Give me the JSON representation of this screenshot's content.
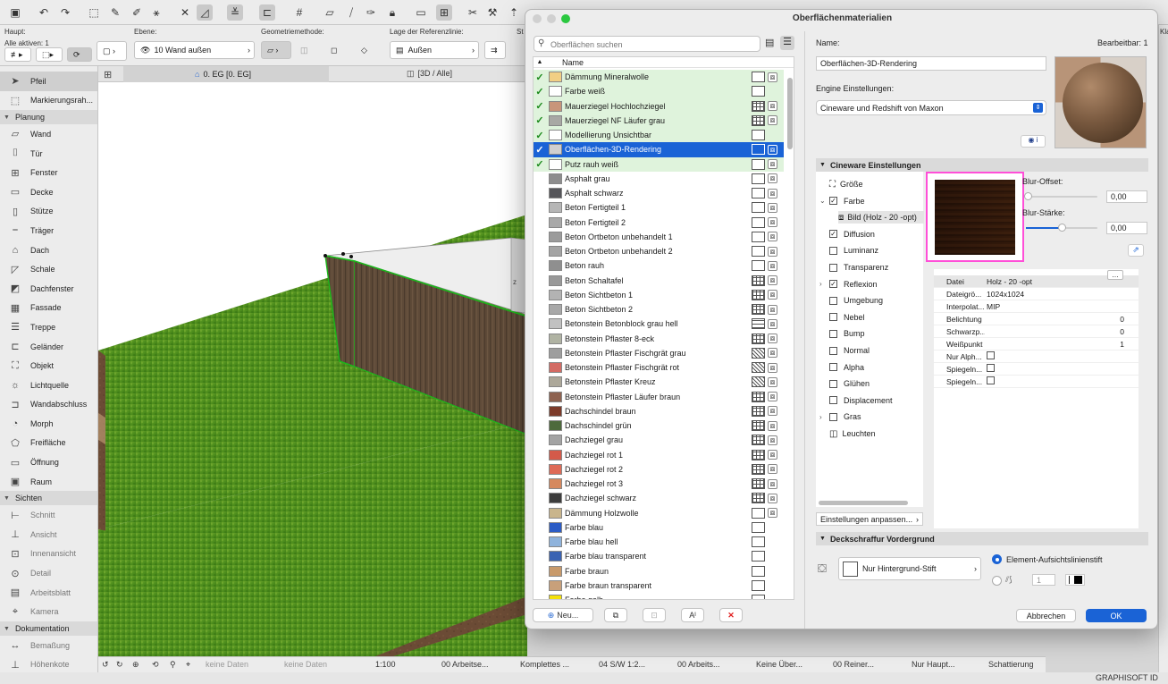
{
  "toolbar": {
    "haupt_label": "Haupt:",
    "alle_aktiven": "Alle aktiven: 1",
    "ebene_label": "Ebene:",
    "ebene_value": "10 Wand außen",
    "geometrie_label": "Geometriemethode:",
    "referenz_label": "Lage der Referenzlinie:",
    "referenz_value": "Außen",
    "st_label": "St"
  },
  "view_tabs": {
    "tab1": "0. EG [0. EG]",
    "tab2": "[3D / Alle]"
  },
  "palette": {
    "pfeil": "Pfeil",
    "markierung": "Markierungsrah...",
    "sections": {
      "planung": "Planung",
      "sichten": "Sichten",
      "dokumentation": "Dokumentation"
    },
    "planung_items": [
      "Wand",
      "Tür",
      "Fenster",
      "Decke",
      "Stütze",
      "Träger",
      "Dach",
      "Schale",
      "Dachfenster",
      "Fassade",
      "Treppe",
      "Geländer",
      "Objekt",
      "Lichtquelle",
      "Wandabschluss",
      "Morph",
      "Freifläche",
      "Öffnung",
      "Raum"
    ],
    "sichten_items": [
      "Schnitt",
      "Ansicht",
      "Innenansicht",
      "Detail",
      "Arbeitsblatt",
      "Kamera"
    ],
    "doku_items": [
      "Bemaßung",
      "Höhenkote"
    ]
  },
  "statusbar": {
    "keine_daten_1": "keine Daten",
    "keine_daten_2": "keine Daten",
    "scale": "1:100",
    "arbeitsebene": "00 Arbeitse...",
    "komplettes": "Komplettes ...",
    "stift": "04 S/W 1:2...",
    "arbeits": "00 Arbeits...",
    "keine_ueber": "Keine Über...",
    "reiner": "00 Reiner...",
    "haupt": "Nur Haupt...",
    "schattierung": "Schattierung"
  },
  "dialog": {
    "title": "Oberflächenmaterialien",
    "search_placeholder": "Oberflächen suchen",
    "list_header": "Name",
    "materials": [
      {
        "name": "Dämmung Mineralwolle",
        "color": "#f2cf84",
        "fav": true,
        "pat": "plain",
        "icon": true
      },
      {
        "name": "Farbe weiß",
        "color": "#ffffff",
        "fav": true,
        "pat": "plain",
        "icon": false
      },
      {
        "name": "Mauerziegel Hochlochziegel",
        "color": "#c8957a",
        "fav": true,
        "pat": "hatch2",
        "icon": true
      },
      {
        "name": "Mauerziegel NF Läufer grau",
        "color": "#a8a8a4",
        "fav": true,
        "pat": "hatch2",
        "icon": true
      },
      {
        "name": "Modellierung Unsichtbar",
        "color": "#ffffff",
        "fav": true,
        "pat": "plain",
        "icon": false
      },
      {
        "name": "Oberflächen-3D-Rendering",
        "color": "#cfcfcf",
        "fav": true,
        "pat": "plain",
        "icon": true,
        "selected": true
      },
      {
        "name": "Putz rauh weiß",
        "color": "#ffffff",
        "fav": true,
        "pat": "plain",
        "icon": true
      },
      {
        "name": "Asphalt grau",
        "color": "#8d8d8d",
        "fav": false,
        "pat": "plain",
        "icon": true
      },
      {
        "name": "Asphalt schwarz",
        "color": "#555559",
        "fav": false,
        "pat": "plain",
        "icon": true
      },
      {
        "name": "Beton Fertigteil 1",
        "color": "#b6b6b6",
        "fav": false,
        "pat": "plain",
        "icon": true
      },
      {
        "name": "Beton Fertigteil 2",
        "color": "#a9a9a9",
        "fav": false,
        "pat": "plain",
        "icon": true
      },
      {
        "name": "Beton Ortbeton unbehandelt 1",
        "color": "#9b9b9b",
        "fav": false,
        "pat": "plain",
        "icon": true
      },
      {
        "name": "Beton Ortbeton unbehandelt 2",
        "color": "#a4a4a4",
        "fav": false,
        "pat": "plain",
        "icon": true
      },
      {
        "name": "Beton rauh",
        "color": "#8f8f8f",
        "fav": false,
        "pat": "plain",
        "icon": true
      },
      {
        "name": "Beton Schaltafel",
        "color": "#999999",
        "fav": false,
        "pat": "hatch2",
        "icon": true
      },
      {
        "name": "Beton Sichtbeton 1",
        "color": "#b3b3b3",
        "fav": false,
        "pat": "hatch2",
        "icon": true
      },
      {
        "name": "Beton Sichtbeton 2",
        "color": "#a8a8a8",
        "fav": false,
        "pat": "hatch2",
        "icon": true
      },
      {
        "name": "Betonstein Betonblock grau hell",
        "color": "#c1c1c1",
        "fav": false,
        "pat": "hatch1",
        "icon": true
      },
      {
        "name": "Betonstein Pflaster 8-eck",
        "color": "#b0b3a3",
        "fav": false,
        "pat": "hatch2",
        "icon": true
      },
      {
        "name": "Betonstein Pflaster Fischgrät grau",
        "color": "#9e9e9e",
        "fav": false,
        "pat": "hatch3",
        "icon": true
      },
      {
        "name": "Betonstein Pflaster Fischgrät rot",
        "color": "#d36b64",
        "fav": false,
        "pat": "hatch3",
        "icon": true
      },
      {
        "name": "Betonstein Pflaster Kreuz",
        "color": "#ada89a",
        "fav": false,
        "pat": "hatch3",
        "icon": true
      },
      {
        "name": "Betonstein Pflaster Läufer braun",
        "color": "#8e6250",
        "fav": false,
        "pat": "hatch2",
        "icon": true
      },
      {
        "name": "Dachschindel braun",
        "color": "#7c3b2a",
        "fav": false,
        "pat": "hatch2",
        "icon": true
      },
      {
        "name": "Dachschindel grün",
        "color": "#4d6a3c",
        "fav": false,
        "pat": "hatch2",
        "icon": true
      },
      {
        "name": "Dachziegel grau",
        "color": "#a3a3a3",
        "fav": false,
        "pat": "hatch2",
        "icon": true
      },
      {
        "name": "Dachziegel rot 1",
        "color": "#d45a4a",
        "fav": false,
        "pat": "hatch2",
        "icon": true
      },
      {
        "name": "Dachziegel rot 2",
        "color": "#de6a57",
        "fav": false,
        "pat": "hatch2",
        "icon": true
      },
      {
        "name": "Dachziegel rot 3",
        "color": "#d6895e",
        "fav": false,
        "pat": "hatch2",
        "icon": true
      },
      {
        "name": "Dachziegel schwarz",
        "color": "#3d3d3d",
        "fav": false,
        "pat": "hatch2",
        "icon": true
      },
      {
        "name": "Dämmung Holzwolle",
        "color": "#c9b58c",
        "fav": false,
        "pat": "plain",
        "icon": true
      },
      {
        "name": "Farbe blau",
        "color": "#2c5cc5",
        "fav": false,
        "pat": "plain",
        "icon": false
      },
      {
        "name": "Farbe blau hell",
        "color": "#8fb3dc",
        "fav": false,
        "pat": "plain",
        "icon": false
      },
      {
        "name": "Farbe blau transparent",
        "color": "#3a63b3",
        "fav": false,
        "pat": "plain",
        "icon": false
      },
      {
        "name": "Farbe braun",
        "color": "#c89a6b",
        "fav": false,
        "pat": "plain",
        "icon": false
      },
      {
        "name": "Farbe braun transparent",
        "color": "#c8a07a",
        "fav": false,
        "pat": "plain",
        "icon": false
      },
      {
        "name": "Farbe gelb",
        "color": "#f4e10a",
        "fav": false,
        "pat": "plain",
        "icon": false
      }
    ],
    "buttons": {
      "neu": "Neu...",
      "abbrechen": "Abbrechen",
      "ok": "OK"
    },
    "name_label": "Name:",
    "editable_label": "Bearbeitbar: 1",
    "name_value": "Oberflächen-3D-Rendering",
    "engine_label": "Engine Einstellungen:",
    "engine_value": "Cineware und Redshift von Maxon",
    "cineware_section": "Cineware Einstellungen",
    "channels": [
      {
        "label": "Größe",
        "check": "none",
        "expand": false
      },
      {
        "label": "Farbe",
        "check": "on",
        "expand": true
      },
      {
        "label": "Bild (Holz - 20 -opt)",
        "check": "img",
        "expand": false
      },
      {
        "label": "Diffusion",
        "check": "on",
        "expand": false
      },
      {
        "label": "Luminanz",
        "check": "off",
        "expand": false
      },
      {
        "label": "Transparenz",
        "check": "off",
        "expand": false
      },
      {
        "label": "Reflexion",
        "check": "on",
        "expand": true
      },
      {
        "label": "Umgebung",
        "check": "off",
        "expand": false
      },
      {
        "label": "Nebel",
        "check": "off",
        "expand": false
      },
      {
        "label": "Bump",
        "check": "off",
        "expand": false
      },
      {
        "label": "Normal",
        "check": "off",
        "expand": false
      },
      {
        "label": "Alpha",
        "check": "off",
        "expand": false
      },
      {
        "label": "Glühen",
        "check": "off",
        "expand": false
      },
      {
        "label": "Displacement",
        "check": "off",
        "expand": false
      },
      {
        "label": "Gras",
        "check": "off",
        "expand": true
      },
      {
        "label": "Leuchten",
        "check": "lamp",
        "expand": false
      }
    ],
    "blur_offset_label": "Blur-Offset:",
    "blur_offset_value": "0,00",
    "blur_staerke_label": "Blur-Stärke:",
    "blur_staerke_value": "0,00",
    "texture_props": [
      {
        "key": "Datei",
        "value": "Holz - 20 -opt",
        "type": "text"
      },
      {
        "key": "Dateigrö...",
        "value": "1024x1024",
        "type": "text"
      },
      {
        "key": "Interpolat...",
        "value": "MIP",
        "type": "text"
      },
      {
        "key": "Belichtung",
        "value": "0",
        "type": "num"
      },
      {
        "key": "Schwarzp...",
        "value": "0",
        "type": "num"
      },
      {
        "key": "Weißpunkt",
        "value": "1",
        "type": "num"
      },
      {
        "key": "Nur Alph...",
        "value": "",
        "type": "check"
      },
      {
        "key": "Spiegeln...",
        "value": "",
        "type": "check"
      },
      {
        "key": "Spiegeln...",
        "value": "",
        "type": "check"
      }
    ],
    "einstellungen_btn": "Einstellungen anpassen...",
    "deckschraffur_section": "Deckschraffur Vordergrund",
    "hintergrund_value": "Nur Hintergrund-Stift",
    "radio_label": "Element-Aufsichtslinienstift",
    "pen_number": "1"
  },
  "right_panel": {
    "brand": "GRAPHISOFT ID",
    "peek_text": "Kla"
  },
  "colors": {
    "accent": "#1a63d6",
    "highlight": "#ff4fd8",
    "favorite_row": "#dff3dc"
  }
}
